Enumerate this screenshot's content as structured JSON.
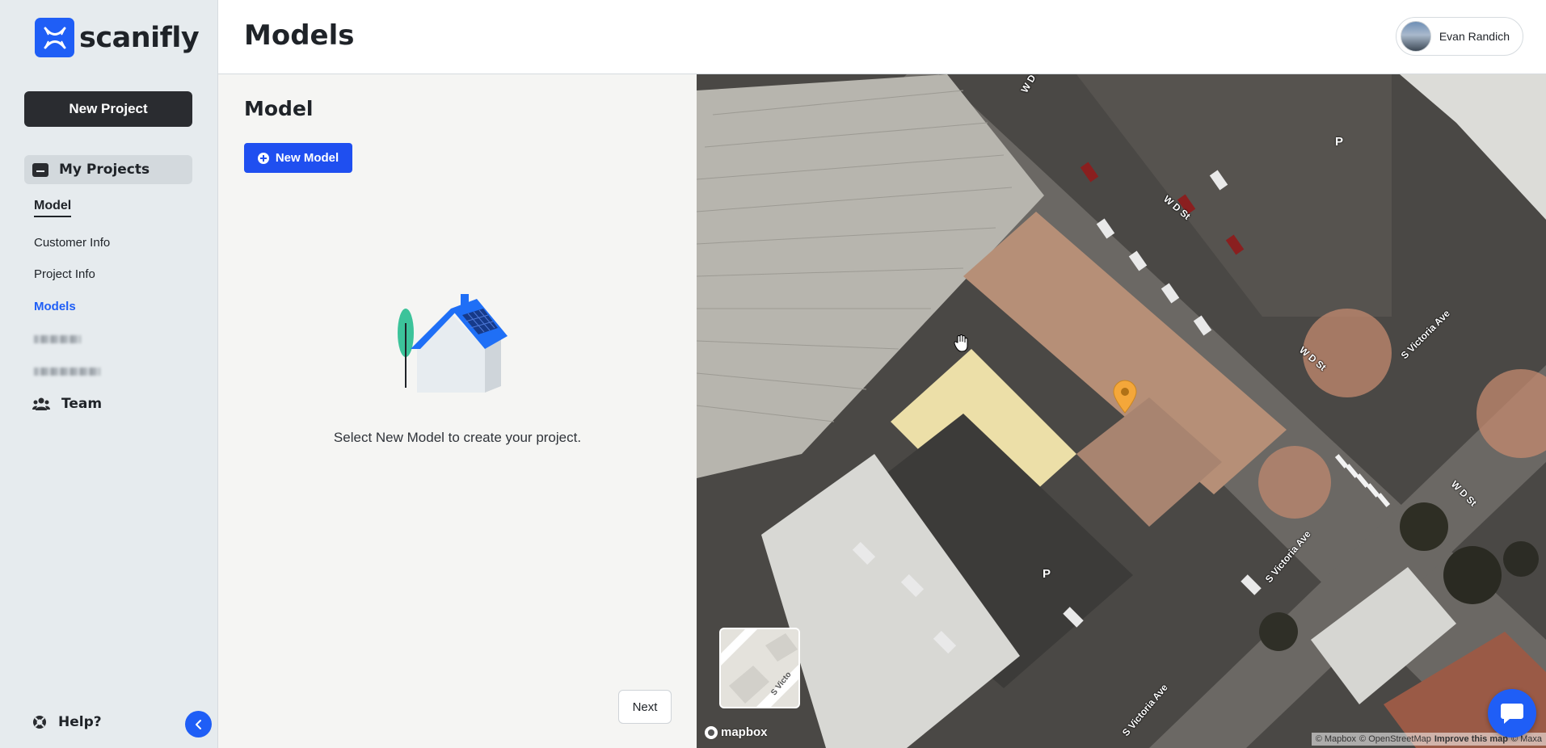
{
  "app": {
    "logo_text": "scanifly"
  },
  "sidebar": {
    "new_project_label": "New Project",
    "my_projects_label": "My Projects",
    "subnav": [
      {
        "label": "Model"
      },
      {
        "label": "Customer Info"
      },
      {
        "label": "Project Info"
      },
      {
        "label": "Models"
      }
    ],
    "team_label": "Team",
    "help_label": "Help?"
  },
  "header": {
    "title": "Models",
    "user_name": "Evan Randich"
  },
  "panel": {
    "title": "Model",
    "new_model_label": "New Model",
    "empty_message": "Select New Model to create your project.",
    "next_label": "Next"
  },
  "map": {
    "streets": [
      "W D St",
      "W D St",
      "W D St",
      "S Victoria Ave",
      "S Victoria Ave",
      "S Victoria Ave",
      "W D St"
    ],
    "parking_label": "P",
    "minimap_street": "S Victo",
    "mapbox_label": "mapbox",
    "attribution": {
      "mapbox": "© Mapbox",
      "osm": "© OpenStreetMap",
      "improve": "Improve this map",
      "maxar": "© Maxa"
    }
  },
  "colors": {
    "accent": "#1f5ef6",
    "sidebar_bg": "#e6ebee",
    "dark_button": "#2a2c30",
    "panel_bg": "#f5f5f3"
  },
  "icons": {
    "folder": "folder-icon",
    "team": "team-icon",
    "help": "lifebuoy-icon",
    "collapse": "chevron-left-icon",
    "chat": "chat-bubble-icon",
    "plus": "plus-circle-icon",
    "pin": "map-pin-icon"
  }
}
